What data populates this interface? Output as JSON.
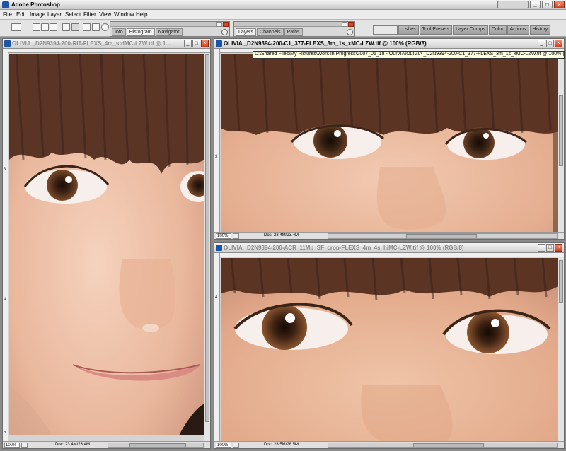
{
  "app": {
    "title": "Adobe Photoshop"
  },
  "menu": [
    "File",
    "Edit",
    "Image",
    "Layer",
    "Select",
    "Filter",
    "View",
    "Window",
    "Help"
  ],
  "palette_well": [
    "...shes",
    "Tool Presets",
    "Layer Comps",
    "Color",
    "Actions",
    "History"
  ],
  "palette_info": {
    "tabs": [
      "Info",
      "Histogram",
      "Navigator"
    ],
    "active": "Histogram"
  },
  "palette_layers": {
    "tabs": [
      "Layers",
      "Channels",
      "Paths"
    ],
    "active": "Layers"
  },
  "windows": [
    {
      "title": "OLIVIA _D2N9394-200-RIT-FLEXS_4m_stdMC-LZW.tif @ 1...",
      "active": false,
      "zoom": "100%",
      "doc": "Doc: 23.4M/23.4M",
      "ruler_marks": [
        "3",
        "4",
        "5"
      ]
    },
    {
      "title": "OLIVIA _D2N9394-200-C1_377-FLEXS_3m_1s_xMC-LZW.tif @ 100% (RGB/8)",
      "active": true,
      "zoom": "100%",
      "doc": "Doc: 23.4M/23.4M",
      "ruler_marks": [
        "3"
      ]
    },
    {
      "title": "OLIVIA _D2N9394-200-ACR_11Mp_SF_crop-FLEXS_4m_4s_hiMC-LZW.tif @ 100% (RGB/8)",
      "active": false,
      "zoom": "100%",
      "doc": "Doc: 28.5M/28.5M",
      "ruler_marks": [
        "4"
      ]
    }
  ],
  "tooltip": "D:\\Shared Files\\My Pictures\\Work In Progress\\2007_05_18 - OLIVIA\\OLIVIA _D2N9394-200-C1_377-FLEXS_3m_1s_xMC-LZW.tif @ 100% (RGB/8)"
}
